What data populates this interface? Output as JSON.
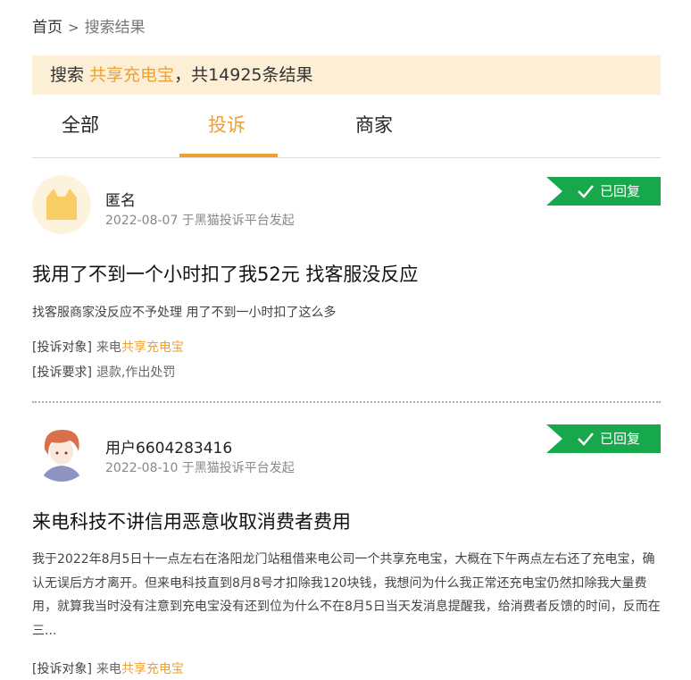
{
  "breadcrumb": {
    "home": "首页",
    "separator": ">",
    "current": "搜索结果"
  },
  "search": {
    "prefix": "搜索 ",
    "keyword": "共享充电宝",
    "suffix": "，共14925条结果"
  },
  "tabs": [
    {
      "label": "全部",
      "active": false
    },
    {
      "label": "投诉",
      "active": true
    },
    {
      "label": "商家",
      "active": false
    }
  ],
  "complaints": [
    {
      "user": "匿名",
      "meta": "2022-08-07 于黑猫投诉平台发起",
      "status": "已回复",
      "title": "我用了不到一个小时扣了我52元 找客服没反应",
      "description": "找客服商家没反应不予处理 用了不到一小时扣了这么多",
      "target_label": "[投诉对象]",
      "target_prefix": "来电",
      "target_keyword": "共享充电宝",
      "request_label": "[投诉要求]",
      "request_value": "退款,作出处罚"
    },
    {
      "user": "用户6604283416",
      "meta": "2022-08-10 于黑猫投诉平台发起",
      "status": "已回复",
      "title": "来电科技不讲信用恶意收取消费者费用",
      "description": "我于2022年8月5日十一点左右在洛阳龙门站租借来电公司一个共享充电宝，大概在下午两点左右还了充电宝，确认无误后方才离开。但来电科技直到8月8号才扣除我120块钱，我想问为什么我正常还充电宝仍然扣除我大量费用，就算我当时没有注意到充电宝没有还到位为什么不在8月5日当天发消息提醒我，给消费者反馈的时间，反而在三...",
      "target_label": "[投诉对象]",
      "target_prefix": "来电",
      "target_keyword": "共享充电宝"
    }
  ],
  "colors": {
    "accent": "#f0a030",
    "banner_bg": "#fcefd6",
    "status_green": "#17a84b"
  }
}
